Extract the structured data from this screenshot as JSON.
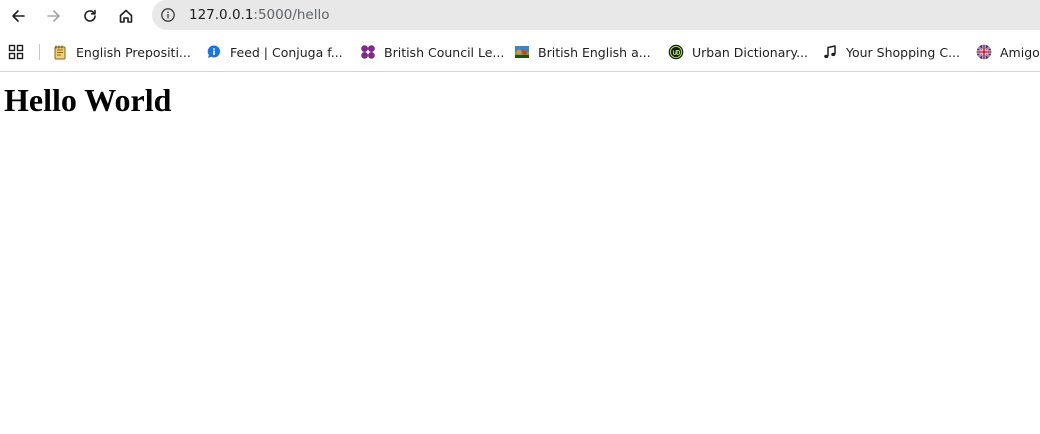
{
  "browser": {
    "url_host": "127.0.0.1",
    "url_rest": ":5000/hello",
    "nav": {
      "back_icon": "arrow-left-icon",
      "forward_icon": "arrow-right-icon",
      "reload_icon": "reload-icon",
      "home_icon": "home-icon"
    },
    "site_info_icon": "info-circle-icon",
    "apps_icon": "apps-grid-icon"
  },
  "bookmarks": [
    {
      "label": "English Prepositi...",
      "icon": "notepad-icon",
      "color": "#c9962e"
    },
    {
      "label": "Feed | Conjuga f...",
      "icon": "info-bubble-icon",
      "color": "#1a73e8"
    },
    {
      "label": "British Council Le...",
      "icon": "clover-icon",
      "color": "#7b2d8e"
    },
    {
      "label": "British English a...",
      "icon": "photo-icon",
      "color": "#5a8f3c"
    },
    {
      "label": "Urban Dictionary...",
      "icon": "ud-badge-icon",
      "color": "#134f5c"
    },
    {
      "label": "Your Shopping C...",
      "icon": "music-note-icon",
      "color": "#1f1f1f"
    },
    {
      "label": "Amigo",
      "icon": "uk-flag-icon",
      "color": "#1d3f8f"
    }
  ],
  "page": {
    "heading": "Hello World"
  }
}
